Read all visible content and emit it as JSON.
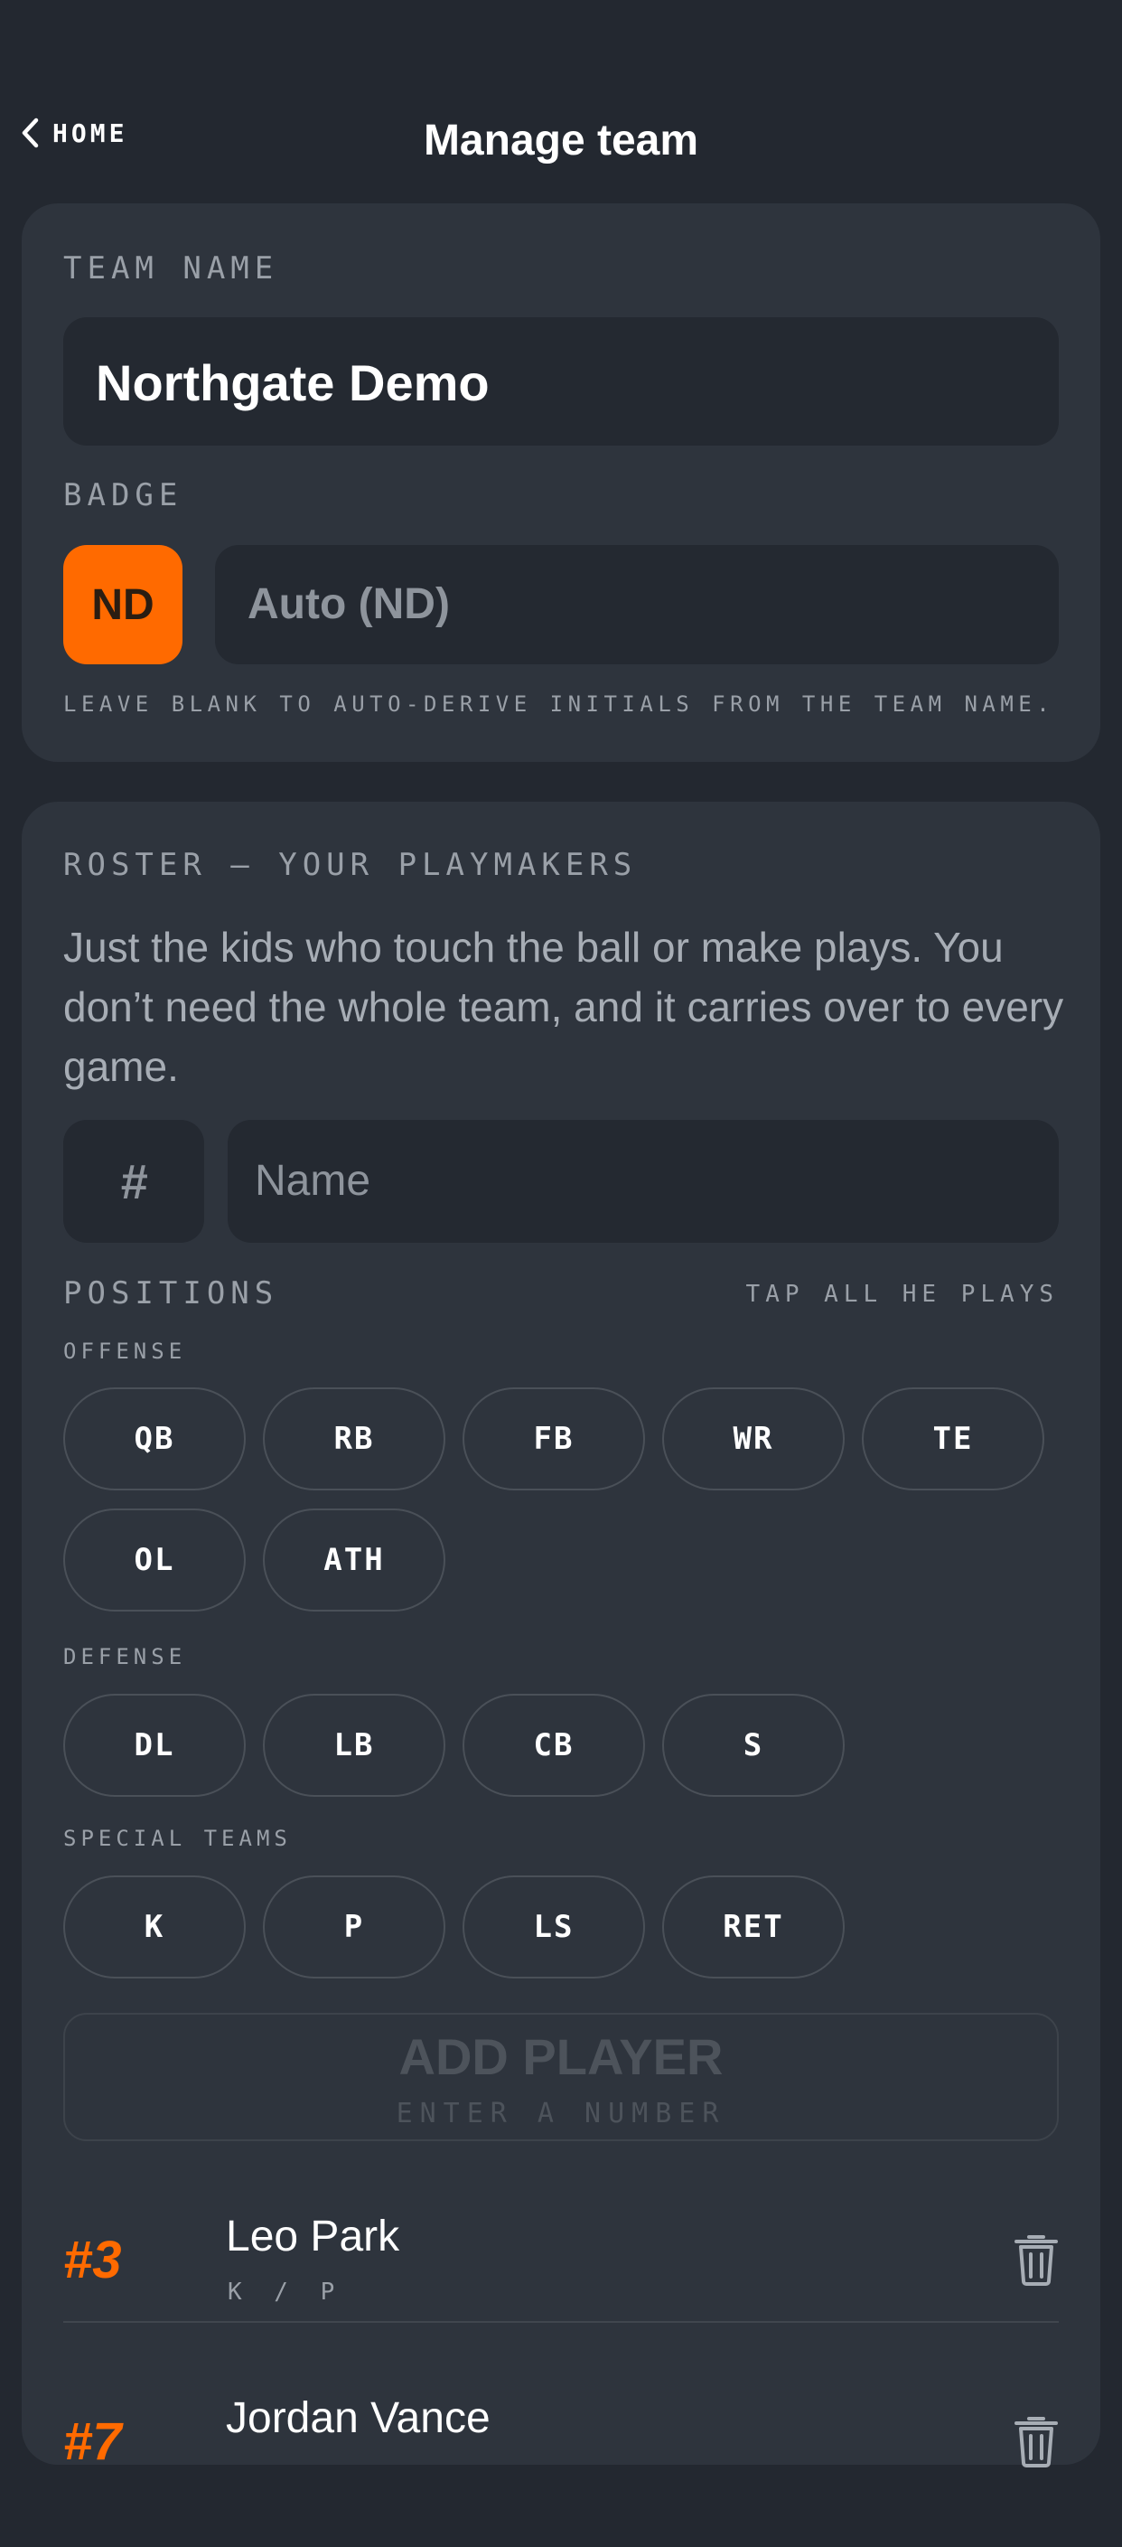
{
  "header": {
    "back_label": "HOME",
    "title": "Manage team"
  },
  "team": {
    "name_label": "TEAM NAME",
    "name_value": "Northgate Demo",
    "badge_label": "BADGE",
    "badge_initials": "ND",
    "badge_placeholder": "Auto (ND)",
    "badge_hint": "LEAVE BLANK TO AUTO-DERIVE INITIALS FROM THE TEAM NAME.",
    "badge_color": "#ff6a00"
  },
  "roster": {
    "label": "ROSTER — YOUR PLAYMAKERS",
    "description": "Just the kids who touch the ball or make plays. You don’t need the whole team, and it carries over to every game.",
    "number_placeholder": "#",
    "name_placeholder": "Name",
    "positions_label": "POSITIONS",
    "positions_hint": "TAP ALL HE PLAYS",
    "offense_label": "OFFENSE",
    "offense": [
      "QB",
      "RB",
      "FB",
      "WR",
      "TE",
      "OL",
      "ATH"
    ],
    "defense_label": "DEFENSE",
    "defense": [
      "DL",
      "LB",
      "CB",
      "S"
    ],
    "special_label": "SPECIAL TEAMS",
    "special": [
      "K",
      "P",
      "LS",
      "RET"
    ],
    "add_button": "ADD PLAYER",
    "add_button_sub": "ENTER A NUMBER",
    "players": [
      {
        "number": "#3",
        "name": "Leo Park",
        "positions": "K / P"
      },
      {
        "number": "#7",
        "name": "Jordan Vance",
        "positions": ""
      }
    ]
  }
}
